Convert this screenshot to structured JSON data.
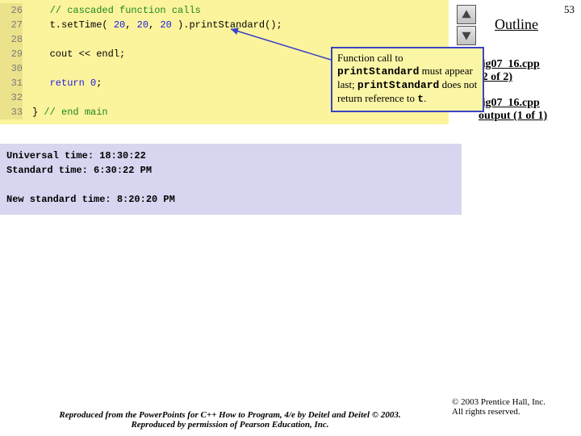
{
  "slide_number": "53",
  "outline_label": "Outline",
  "code": {
    "lines": [
      {
        "n": "26",
        "pre": "   ",
        "a": "// cascaded function calls",
        "cls": "cgreen"
      },
      {
        "n": "27",
        "pre": "   ",
        "plain": "t.setTime( ",
        "n1": "20",
        "s1": ", ",
        "n2": "20",
        "s2": ", ",
        "n3": "20",
        "rest": " ).printStandard();"
      },
      {
        "n": "28",
        "pre": "",
        "a": "",
        "cls": ""
      },
      {
        "n": "29",
        "pre": "   ",
        "plain": "cout << endl;"
      },
      {
        "n": "30",
        "pre": "",
        "a": "",
        "cls": ""
      },
      {
        "n": "31",
        "pre": "   ",
        "kw": "return",
        "rest2": " ",
        "num": "0",
        "semi": ";"
      },
      {
        "n": "32",
        "pre": "",
        "a": "",
        "cls": ""
      },
      {
        "n": "33",
        "pre": "",
        "brace": "} ",
        "cm": "// end main"
      }
    ]
  },
  "output": {
    "line1": "Universal time: 18:30:22",
    "line2": "Standard time: 6:30:22 PM",
    "blank": "",
    "line3": "New standard time: 8:20:20 PM"
  },
  "files": {
    "f1_name": "fig07_16.cpp",
    "f1_part": "(2 of 2)",
    "f2_name": "fig07_16.cpp",
    "f2_part": "output (1 of 1)"
  },
  "callout": {
    "t1": "Function call to ",
    "m1": "printStandard",
    "t2": " must appear last; ",
    "m2": "printStandard",
    "t3": " does not return reference to ",
    "m3": "t",
    "t4": "."
  },
  "copyright_l1": "© 2003 Prentice Hall, Inc.",
  "copyright_l2": "All rights reserved.",
  "repro": "Reproduced from the PowerPoints for C++ How to Program, 4/e by Deitel and Deitel © 2003. Reproduced by permission of Pearson Education, Inc."
}
